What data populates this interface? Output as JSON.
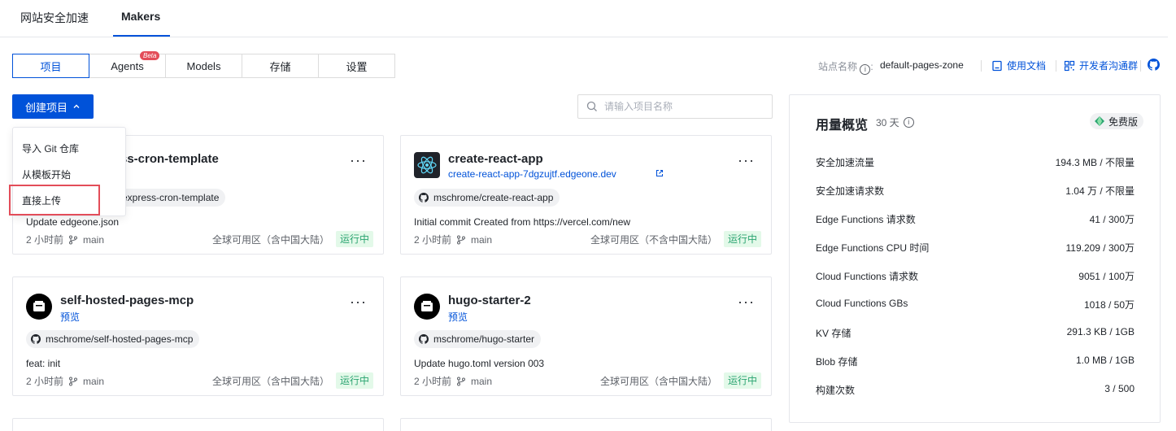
{
  "top_tabs": [
    "网站安全加速",
    "Makers"
  ],
  "nav": {
    "items": [
      "项目",
      "Agents",
      "Models",
      "存储",
      "设置"
    ],
    "beta": "Beta"
  },
  "site": {
    "label": "站点名称",
    "value": "default-pages-zone",
    "docs": "使用文档",
    "community": "开发者沟通群"
  },
  "create_button": "创建项目",
  "search": {
    "placeholder": "请输入项目名称",
    "value": ""
  },
  "dropdown": [
    "导入 Git 仓库",
    "从模板开始",
    "直接上传"
  ],
  "cards": [
    {
      "title": "ss-cron-template",
      "repo": "express-cron-template",
      "commit": "Update edgeone.json",
      "time": "2 小时前",
      "branch": "main",
      "region": "全球可用区（含中国大陆）",
      "status": "运行中"
    },
    {
      "title": "create-react-app",
      "url": "create-react-app-7dgzujtf.edgeone.dev",
      "repo": "mschrome/create-react-app",
      "commit": "Initial commit Created from https://vercel.com/new",
      "time": "2 小时前",
      "branch": "main",
      "region": "全球可用区（不含中国大陆）",
      "status": "运行中"
    },
    {
      "title": "self-hosted-pages-mcp",
      "sub": "预览",
      "repo": "mschrome/self-hosted-pages-mcp",
      "commit": "feat: init",
      "time": "2 小时前",
      "branch": "main",
      "region": "全球可用区（含中国大陆）",
      "status": "运行中"
    },
    {
      "title": "hugo-starter-2",
      "sub": "预览",
      "repo": "mschrome/hugo-starter",
      "commit": "Update hugo.toml version 003",
      "time": "2 小时前",
      "branch": "main",
      "region": "全球可用区（含中国大陆）",
      "status": "运行中"
    }
  ],
  "usage": {
    "title": "用量概览",
    "period": "30 天",
    "plan": "免费版",
    "rows": [
      {
        "label": "安全加速流量",
        "value": "194.3 MB / 不限量"
      },
      {
        "label": "安全加速请求数",
        "value": "1.04 万 / 不限量"
      },
      {
        "label": "Edge Functions 请求数",
        "value": "41 / 300万"
      },
      {
        "label": "Edge Functions CPU 时间",
        "value": "119.209 / 300万"
      },
      {
        "label": "Cloud Functions 请求数",
        "value": "9051 / 100万"
      },
      {
        "label": "Cloud Functions GBs",
        "value": "1018 / 50万"
      },
      {
        "label": "KV 存储",
        "value": "291.3 KB / 1GB"
      },
      {
        "label": "Blob 存储",
        "value": "1.0 MB / 1GB"
      },
      {
        "label": "构建次数",
        "value": "3 / 500"
      }
    ]
  },
  "colors": {
    "primary": "#0052d9",
    "success": "#2ba471",
    "danger": "#e34d59"
  }
}
